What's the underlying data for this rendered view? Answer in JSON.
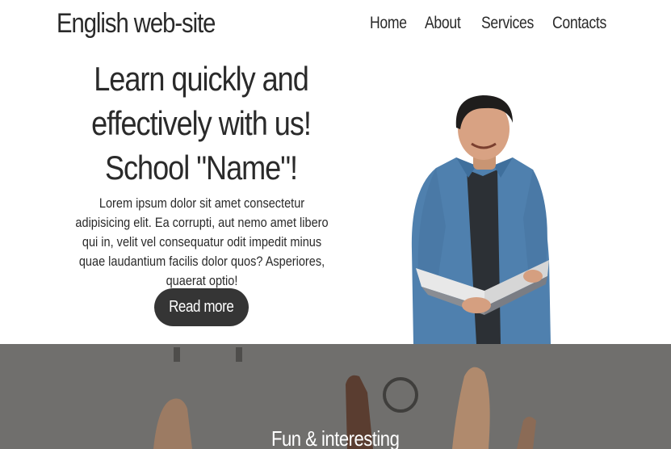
{
  "header": {
    "logo": "English web-site",
    "nav": [
      {
        "label": "Home"
      },
      {
        "label": "About"
      },
      {
        "label": "Services"
      },
      {
        "label": "Contacts"
      }
    ]
  },
  "hero": {
    "title_lines": [
      "Learn quickly and",
      "effectively with us!",
      "School \"Name\"!"
    ],
    "description": "Lorem ipsum dolor sit amet consectetur adipisicing elit. Ea corrupti, aut nemo amet libero qui in, velit vel consequatur odit impedit minus quae laudantium facilis dolor quos? Asperiores, quaerat optio!",
    "button_label": "Read more"
  },
  "band": {
    "title": "Fun & interesting"
  },
  "colors": {
    "text": "#2a2a2a",
    "button": "#353535",
    "band": "#6f6e6c",
    "shirt": "#4d7fae"
  }
}
